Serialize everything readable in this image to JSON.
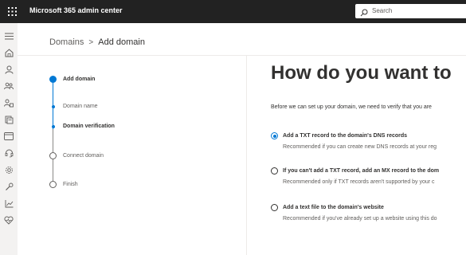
{
  "topbar": {
    "app_title": "Microsoft 365 admin center",
    "search_placeholder": "Search"
  },
  "nav_rail": {
    "icons": [
      "hamburger-icon",
      "home-icon",
      "user-icon",
      "groups-icon",
      "roles-icon",
      "billing-icon",
      "resources-icon",
      "support-icon",
      "settings-icon",
      "setup-icon",
      "reports-icon",
      "health-icon"
    ]
  },
  "breadcrumb": {
    "parent": "Domains",
    "separator": ">",
    "current": "Add domain"
  },
  "steps": [
    {
      "label": "Add domain",
      "state": "current"
    },
    {
      "label": "Domain name",
      "state": "substep"
    },
    {
      "label": "Domain verification",
      "state": "substep-current"
    },
    {
      "label": "Connect domain",
      "state": "upcoming"
    },
    {
      "label": "Finish",
      "state": "upcoming"
    }
  ],
  "main": {
    "heading": "How do you want to",
    "intro": "Before we can set up your domain, we need to verify that you are",
    "options": [
      {
        "title": "Add a TXT record to the domain's DNS records",
        "description": "Recommended if you can create new DNS records at your reg",
        "selected": true
      },
      {
        "title": "If you can't add a TXT record, add an MX record to the dom",
        "description": "Recommended only if TXT records aren't supported by your c",
        "selected": false
      },
      {
        "title": "Add a text file to the domain's website",
        "description": "Recommended if you've already set up a website using this do",
        "selected": false
      }
    ]
  },
  "colors": {
    "accent": "#0078d4",
    "topbar": "#222222",
    "rail": "#f3f2f1"
  }
}
